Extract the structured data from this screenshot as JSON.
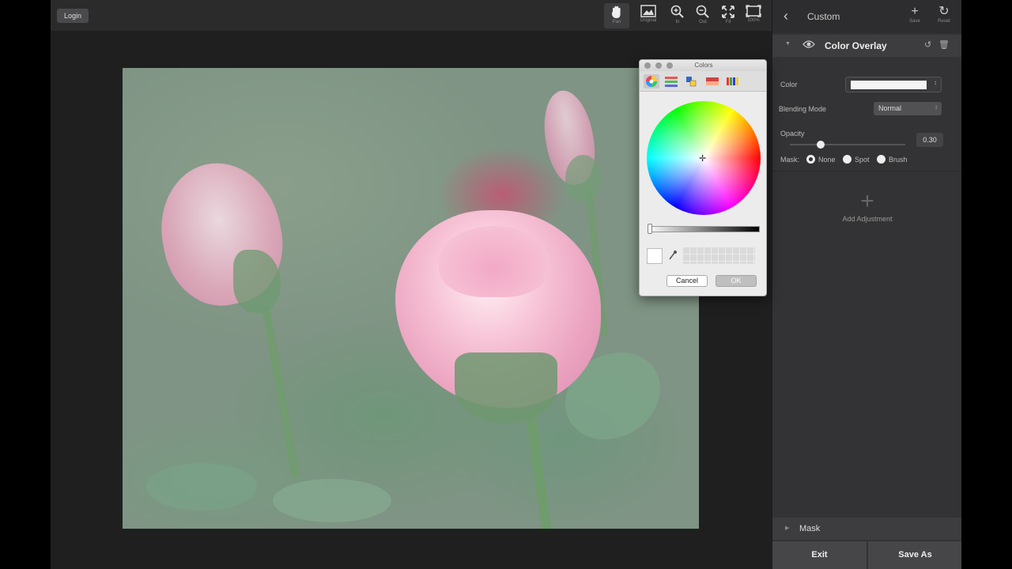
{
  "header": {
    "login_label": "Login"
  },
  "toolbar": {
    "tools": [
      {
        "label": "Pan",
        "icon": "hand-icon"
      },
      {
        "label": "Original",
        "icon": "image-icon"
      },
      {
        "label": "In",
        "icon": "zoom-in-icon"
      },
      {
        "label": "Out",
        "icon": "zoom-out-icon"
      },
      {
        "label": "Fit",
        "icon": "fit-icon"
      },
      {
        "label": "100%",
        "icon": "actual-size-icon"
      }
    ]
  },
  "panel": {
    "preset_name": "Custom",
    "save_label": "Save",
    "reset_label": "Reset",
    "adjustment": {
      "title": "Color Overlay",
      "color_label": "Color",
      "color_value": "#f4f4f4",
      "blending_label": "Blending Mode",
      "blending_value": "Normal",
      "opacity_label": "Opacity",
      "opacity_value": "0.30",
      "mask_label": "Mask:",
      "mask_options": [
        "None",
        "Spot",
        "Brush"
      ],
      "mask_selected": "None"
    },
    "add_adjustment_label": "Add Adjustment",
    "mask_section_title": "Mask",
    "exit_label": "Exit",
    "save_as_label": "Save As"
  },
  "colors_dialog": {
    "title": "Colors",
    "cancel_label": "Cancel",
    "ok_label": "OK",
    "selected_color": "#ffffff"
  },
  "colors": {
    "app_bg": "#2a2a2b",
    "panel_bg": "#333335",
    "dialog_bg": "#ececec"
  }
}
